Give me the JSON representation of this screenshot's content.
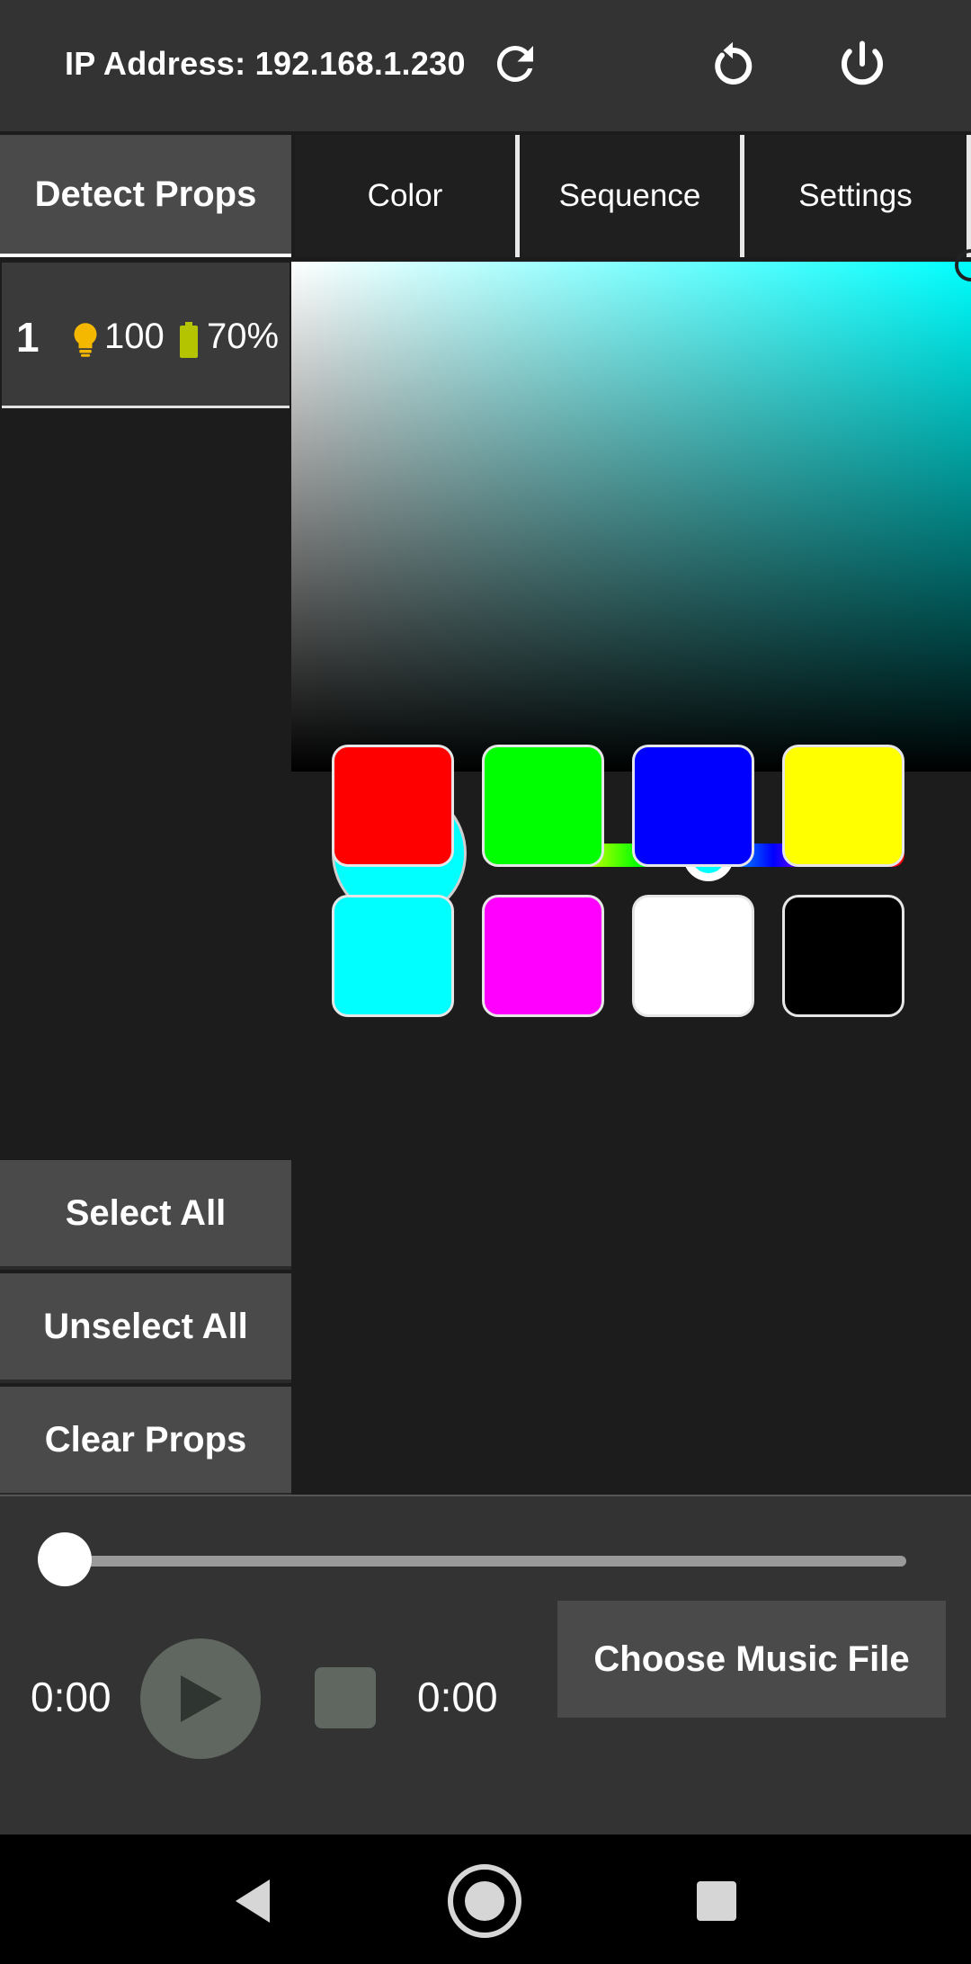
{
  "header": {
    "ip_label": "IP Address: 192.168.1.230",
    "icons": [
      "refresh-icon",
      "reset-icon",
      "power-icon"
    ]
  },
  "tabs": [
    {
      "label": "Detect Props"
    },
    {
      "label": "Color"
    },
    {
      "label": "Sequence"
    },
    {
      "label": "Settings"
    }
  ],
  "props": [
    {
      "number": "1",
      "brightness": "100",
      "battery": "70%"
    }
  ],
  "sidebar": {
    "select_all": "Select All",
    "unselect_all": "Unselect All",
    "clear_props": "Clear Props"
  },
  "color": {
    "current": "#00ffff",
    "hue_fraction": 0.5,
    "swatches": [
      "#ff0000",
      "#00ff00",
      "#0000ff",
      "#ffff00",
      "#00ffff",
      "#ff00ff",
      "#ffffff",
      "#000000"
    ]
  },
  "player": {
    "elapsed": "0:00",
    "duration": "0:00",
    "progress_fraction": 0,
    "choose_music_label": "Choose Music File"
  },
  "colors": {
    "header_bg": "#333333",
    "panel_bg": "#1c1c1c",
    "button_bg": "#4a4a4a",
    "bulb": "#f5b800",
    "battery": "#b5c400"
  }
}
